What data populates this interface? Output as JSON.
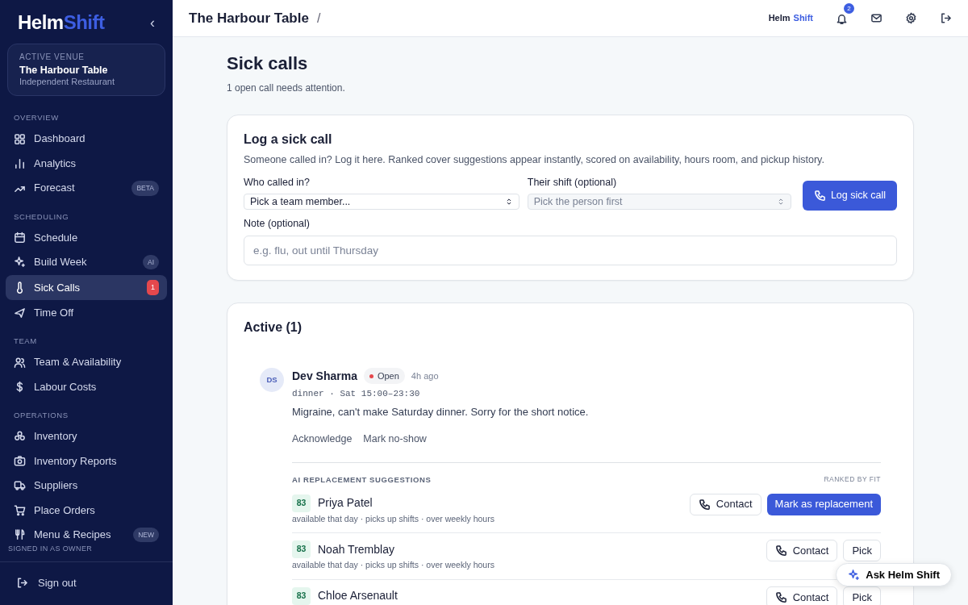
{
  "sidebar": {
    "logo": {
      "first": "Helm",
      "second": "Shift"
    },
    "collapse": "‹",
    "venue": {
      "label": "ACTIVE VENUE",
      "name": "The Harbour Table",
      "type": "Independent Restaurant"
    },
    "sections": [
      {
        "title": "OVERVIEW",
        "items": [
          {
            "label": "Dashboard",
            "selected": false
          },
          {
            "label": "Analytics",
            "selected": false
          },
          {
            "label": "Forecast",
            "selected": false,
            "badge": {
              "text": "BETA",
              "kind": "tag"
            }
          }
        ]
      },
      {
        "title": "SCHEDULING",
        "items": [
          {
            "label": "Schedule",
            "selected": false
          },
          {
            "label": "Build Week",
            "selected": false,
            "badge": {
              "text": "AI",
              "kind": "tag"
            }
          },
          {
            "label": "Sick Calls",
            "selected": true,
            "badge": {
              "text": "1",
              "kind": "count"
            }
          },
          {
            "label": "Time Off",
            "selected": false
          }
        ]
      },
      {
        "title": "TEAM",
        "items": [
          {
            "label": "Team & Availability",
            "selected": false
          },
          {
            "label": "Labour Costs",
            "selected": false
          }
        ]
      },
      {
        "title": "OPERATIONS",
        "items": [
          {
            "label": "Inventory",
            "selected": false
          },
          {
            "label": "Inventory Reports",
            "selected": false
          },
          {
            "label": "Suppliers",
            "selected": false
          },
          {
            "label": "Place Orders",
            "selected": false
          },
          {
            "label": "Menu & Recipes",
            "selected": false,
            "badge": {
              "text": "NEW",
              "kind": "tag"
            }
          }
        ]
      }
    ],
    "signed_in": "SIGNED IN AS OWNER",
    "sign_out": "Sign out"
  },
  "topbar": {
    "breadcrumb": "The Harbour Table",
    "separator": "/",
    "brand": {
      "first": "Helm",
      "second": "Shift"
    },
    "notifications": "2"
  },
  "page": {
    "title": "Sick calls",
    "subtitle": "1 open call needs attention."
  },
  "log_form": {
    "title": "Log a sick call",
    "description": "Someone called in? Log it here. Ranked cover suggestions appear instantly, scored on availability, hours room, and pickup history.",
    "selects": [
      {
        "label": "Who called in?",
        "value": "Pick a team member...",
        "disabled": false
      },
      {
        "label": "Their shift (optional)",
        "value": "Pick the person first",
        "disabled": true
      }
    ],
    "button": "Log sick call",
    "note": {
      "label": "Note (optional)",
      "placeholder": "e.g. flu, out until Thursday"
    }
  },
  "active": {
    "title": "Active (1)",
    "calls": [
      {
        "initials": "DS",
        "name": "Dev Sharma",
        "status": {
          "label": "Open",
          "color": "#e5484d"
        },
        "time": "4h ago",
        "shift": "dinner · Sat 15:00–23:30",
        "message": "Migraine, can't make Saturday dinner. Sorry for the short notice.",
        "actions": [
          "Acknowledge",
          "Mark no-show"
        ],
        "suggestions_title": "AI REPLACEMENT SUGGESTIONS",
        "ranking": "RANKED BY FIT",
        "suggestions": [
          {
            "score": "83",
            "name": "Priya Patel",
            "details": "available that day · picks up shifts · over weekly hours",
            "buttons": [
              {
                "label": "Contact",
                "kind": "contact"
              },
              {
                "label": "Mark as replacement",
                "kind": "primary"
              }
            ]
          },
          {
            "score": "83",
            "name": "Noah Tremblay",
            "details": "available that day · picks up shifts · over weekly hours",
            "buttons": [
              {
                "label": "Contact",
                "kind": "contact"
              },
              {
                "label": "Pick",
                "kind": "outline"
              }
            ]
          },
          {
            "score": "83",
            "name": "Chloe Arsenault",
            "buttons": [
              {
                "label": "Contact",
                "kind": "contact"
              },
              {
                "label": "Pick",
                "kind": "outline"
              }
            ]
          }
        ]
      }
    ]
  },
  "assistant": {
    "label": "Ask Helm Shift"
  }
}
